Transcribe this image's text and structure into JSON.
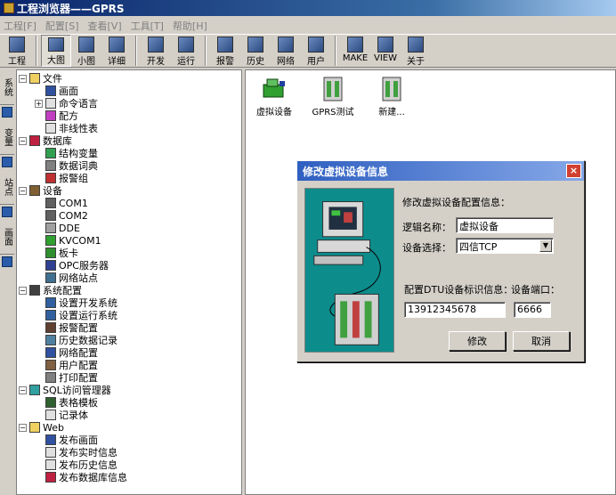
{
  "window": {
    "title": "工程浏览器——GPRS"
  },
  "menu": [
    "工程[F]",
    "配置[S]",
    "查看[V]",
    "工具[T]",
    "帮助[H]"
  ],
  "toolbar": [
    {
      "label": "工程",
      "icon": "project-icon"
    },
    {
      "label": "大图",
      "icon": "large-icons-icon",
      "pressed": true
    },
    {
      "label": "小图",
      "icon": "small-icons-icon"
    },
    {
      "label": "详细",
      "icon": "details-icon"
    },
    {
      "label": "开发",
      "icon": "develop-icon"
    },
    {
      "label": "运行",
      "icon": "run-icon"
    },
    {
      "label": "报警",
      "icon": "alarm-icon"
    },
    {
      "label": "历史",
      "icon": "history-icon"
    },
    {
      "label": "网络",
      "icon": "network-icon"
    },
    {
      "label": "用户",
      "icon": "user-icon"
    },
    {
      "label": "MAKE",
      "icon": "make-icon"
    },
    {
      "label": "VIEW",
      "icon": "view-icon"
    },
    {
      "label": "关于",
      "icon": "about-icon"
    }
  ],
  "sidetabs": [
    "系统",
    "变量",
    "站点",
    "画面"
  ],
  "tree": [
    {
      "label": "文件",
      "level": 0,
      "toggle": "−",
      "icon": "folder-icon",
      "color": "#f0d060"
    },
    {
      "label": "画面",
      "level": 1,
      "icon": "screen-icon",
      "color": "#3050a0"
    },
    {
      "label": "命令语言",
      "level": 1,
      "toggle": "+",
      "icon": "command-icon",
      "color": "#e0e0e0"
    },
    {
      "label": "配方",
      "level": 1,
      "icon": "recipe-icon",
      "color": "#c040c0"
    },
    {
      "label": "非线性表",
      "level": 1,
      "icon": "nonlinear-table-icon",
      "color": "#e0e0e0"
    },
    {
      "label": "数据库",
      "level": 0,
      "toggle": "−",
      "icon": "database-icon",
      "color": "#c02040"
    },
    {
      "label": "结构变量",
      "level": 1,
      "icon": "struct-var-icon",
      "color": "#30a050"
    },
    {
      "label": "数据词典",
      "level": 1,
      "icon": "data-dict-icon",
      "color": "#808080"
    },
    {
      "label": "报警组",
      "level": 1,
      "icon": "alarm-group-icon",
      "color": "#c03030"
    },
    {
      "label": "设备",
      "level": 0,
      "toggle": "−",
      "icon": "device-icon",
      "color": "#806030"
    },
    {
      "label": "COM1",
      "level": 1,
      "icon": "com-port-icon",
      "color": "#606060"
    },
    {
      "label": "COM2",
      "level": 1,
      "icon": "com-port-icon",
      "color": "#606060"
    },
    {
      "label": "DDE",
      "level": 1,
      "icon": "dde-icon",
      "color": "#a0a0a0"
    },
    {
      "label": "KVCOM1",
      "level": 1,
      "icon": "virtual-device-icon",
      "color": "#30a030"
    },
    {
      "label": "板卡",
      "level": 1,
      "icon": "board-card-icon",
      "color": "#309030"
    },
    {
      "label": "OPC服务器",
      "level": 1,
      "icon": "opc-server-icon",
      "color": "#304090"
    },
    {
      "label": "网络站点",
      "level": 1,
      "icon": "network-station-icon",
      "color": "#407090"
    },
    {
      "label": "系统配置",
      "level": 0,
      "toggle": "−",
      "icon": "tools-icon",
      "color": "#404040"
    },
    {
      "label": "设置开发系统",
      "level": 1,
      "icon": "dev-settings-icon",
      "color": "#3060a0"
    },
    {
      "label": "设置运行系统",
      "level": 1,
      "icon": "run-settings-icon",
      "color": "#3060a0"
    },
    {
      "label": "报警配置",
      "level": 1,
      "icon": "alarm-config-icon",
      "color": "#604030"
    },
    {
      "label": "历史数据记录",
      "level": 1,
      "icon": "history-record-icon",
      "color": "#5080a0"
    },
    {
      "label": "网络配置",
      "level": 1,
      "icon": "network-config-icon",
      "color": "#3050a0"
    },
    {
      "label": "用户配置",
      "level": 1,
      "icon": "user-config-icon",
      "color": "#806040"
    },
    {
      "label": "打印配置",
      "level": 1,
      "icon": "print-config-icon",
      "color": "#808080"
    },
    {
      "label": "SQL访问管理器",
      "level": 0,
      "toggle": "−",
      "icon": "sql-manager-icon",
      "color": "#30a0a0"
    },
    {
      "label": "表格模板",
      "level": 1,
      "icon": "table-template-icon",
      "color": "#306030"
    },
    {
      "label": "记录体",
      "level": 1,
      "icon": "record-icon",
      "color": "#e0e0e0"
    },
    {
      "label": "Web",
      "level": 0,
      "toggle": "−",
      "icon": "folder-icon",
      "color": "#f0d060"
    },
    {
      "label": "发布画面",
      "level": 1,
      "icon": "publish-screen-icon",
      "color": "#3050a0"
    },
    {
      "label": "发布实时信息",
      "level": 1,
      "icon": "publish-realtime-icon",
      "color": "#e0e0e0"
    },
    {
      "label": "发布历史信息",
      "level": 1,
      "icon": "publish-history-icon",
      "color": "#e0e0e0"
    },
    {
      "label": "发布数据库信息",
      "level": 1,
      "icon": "publish-database-icon",
      "color": "#c02040"
    }
  ],
  "main_items": [
    {
      "label": "虚拟设备",
      "icon": "virtual-device-icon"
    },
    {
      "label": "GPRS测试",
      "icon": "gprs-device-icon"
    },
    {
      "label": "新建...",
      "icon": "new-device-icon"
    }
  ],
  "dialog": {
    "title": "修改虚拟设备信息",
    "close": "×",
    "section_title": "修改虚拟设备配置信息：",
    "logic_name_label": "逻辑名称：",
    "logic_name_value": "虚拟设备",
    "device_select_label": "设备选择：",
    "device_select_value": "四信TCP",
    "dtu_label": "配置DTU设备标识信息：",
    "port_label": "设备端口：",
    "dtu_value": "13912345678",
    "port_value": "6666",
    "ok_label": "修改",
    "cancel_label": "取消"
  }
}
